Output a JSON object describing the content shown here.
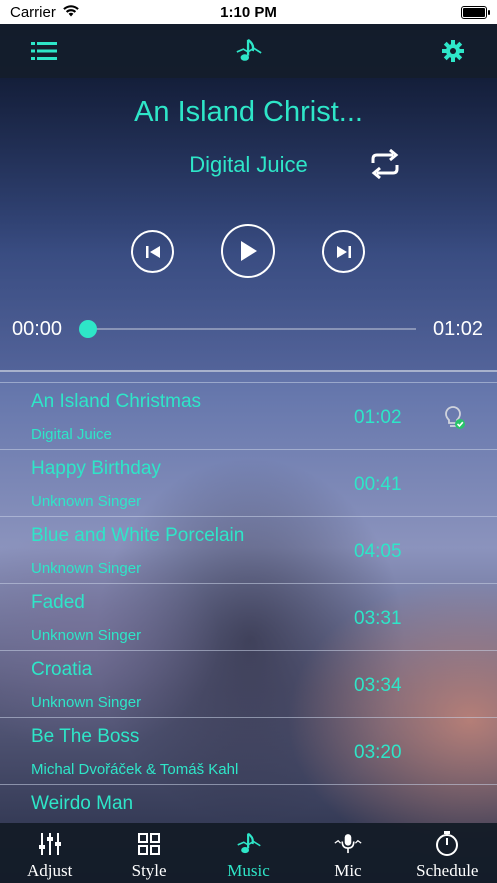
{
  "status_bar": {
    "carrier": "Carrier",
    "time": "1:10 PM"
  },
  "colors": {
    "accent": "#2ee6c8",
    "nav_bg": "#121b28",
    "text_white": "#ffffff"
  },
  "top_nav": {
    "left_icon": "list-icon",
    "center_icon": "music-note-icon",
    "right_icon": "gear-icon"
  },
  "player": {
    "title": "An Island Christ...",
    "artist": "Digital Juice",
    "current_time": "00:00",
    "total_time": "01:02",
    "progress": 0.0
  },
  "songs": [
    {
      "title": "An Island Christmas",
      "artist": "Digital Juice",
      "duration": "01:02",
      "playing": true
    },
    {
      "title": "Happy Birthday",
      "artist": "Unknown Singer",
      "duration": "00:41",
      "playing": false
    },
    {
      "title": "Blue and White Porcelain",
      "artist": "Unknown Singer",
      "duration": "04:05",
      "playing": false
    },
    {
      "title": "Faded",
      "artist": "Unknown Singer",
      "duration": "03:31",
      "playing": false
    },
    {
      "title": "Croatia",
      "artist": "Unknown Singer",
      "duration": "03:34",
      "playing": false
    },
    {
      "title": "Be The Boss",
      "artist": "Michal Dvořáček & Tomáš Kahl",
      "duration": "03:20",
      "playing": false
    },
    {
      "title": "Weirdo Man",
      "artist": "",
      "duration": "",
      "playing": false
    }
  ],
  "tabs": [
    {
      "label": "Adjust",
      "icon": "sliders-icon",
      "active": false
    },
    {
      "label": "Style",
      "icon": "grid-icon",
      "active": false
    },
    {
      "label": "Music",
      "icon": "music-note-icon",
      "active": true
    },
    {
      "label": "Mic",
      "icon": "microphone-icon",
      "active": false
    },
    {
      "label": "Schedule",
      "icon": "timer-icon",
      "active": false
    }
  ]
}
